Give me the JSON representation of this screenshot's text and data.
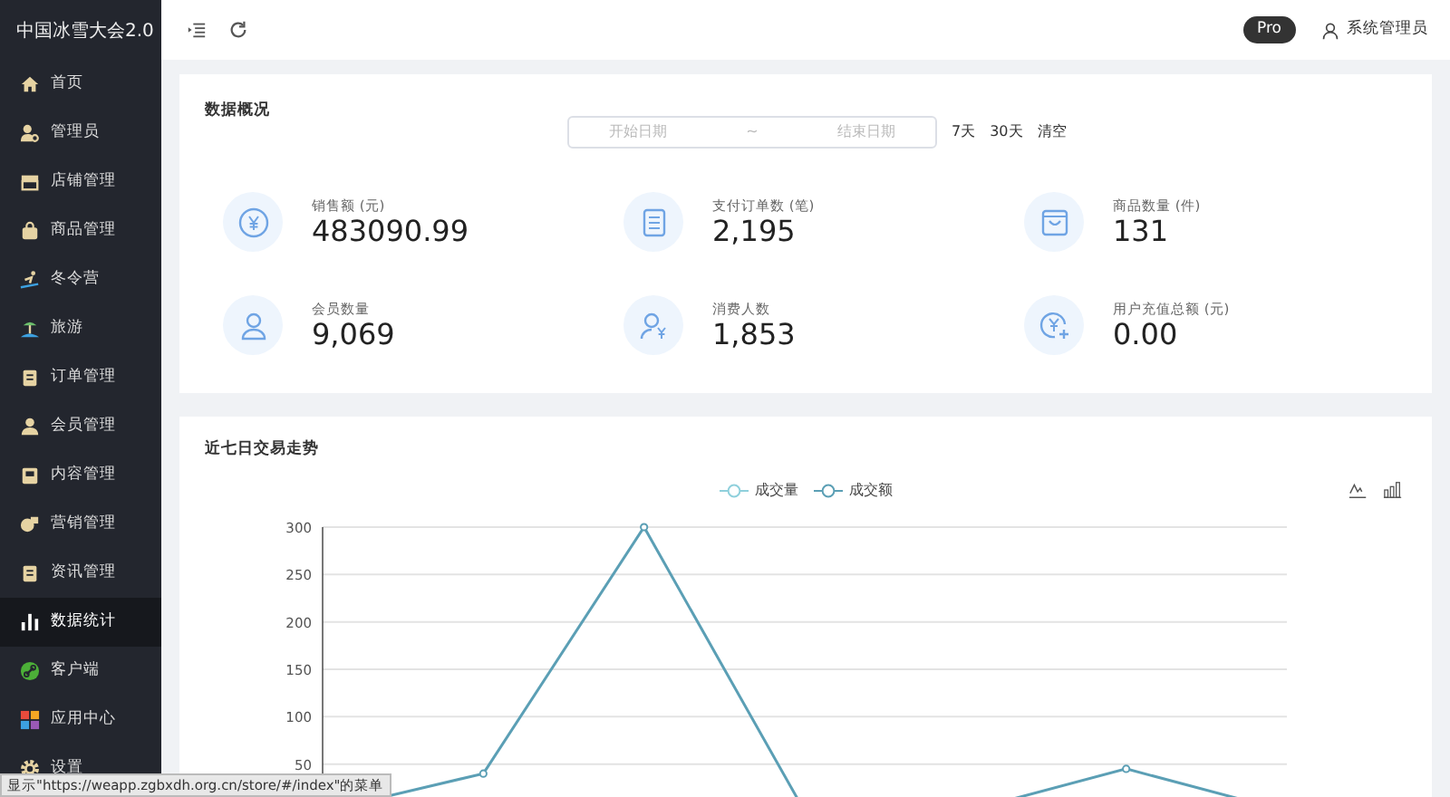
{
  "sidebar": {
    "title": "中国冰雪大会2.0",
    "items": [
      {
        "label": "首页",
        "selected": false
      },
      {
        "label": "管理员",
        "selected": false
      },
      {
        "label": "店铺管理",
        "selected": false
      },
      {
        "label": "商品管理",
        "selected": false
      },
      {
        "label": "冬令营",
        "selected": false
      },
      {
        "label": "旅游",
        "selected": false
      },
      {
        "label": "订单管理",
        "selected": false
      },
      {
        "label": "会员管理",
        "selected": false
      },
      {
        "label": "内容管理",
        "selected": false
      },
      {
        "label": "营销管理",
        "selected": false
      },
      {
        "label": "资讯管理",
        "selected": false
      },
      {
        "label": "数据统计",
        "selected": true
      },
      {
        "label": "客户端",
        "selected": false
      },
      {
        "label": "应用中心",
        "selected": false
      },
      {
        "label": "设置",
        "selected": false
      }
    ]
  },
  "header": {
    "badge": "Pro",
    "user": "系统管理员"
  },
  "overview": {
    "title": "数据概况",
    "date_range": {
      "start_placeholder": "开始日期",
      "separator": "~",
      "end_placeholder": "结束日期"
    },
    "quick_links": [
      "7天",
      "30天",
      "清空"
    ],
    "stats": [
      {
        "label": "销售额 (元)",
        "value": "483090.99"
      },
      {
        "label": "支付订单数 (笔)",
        "value": "2,195"
      },
      {
        "label": "商品数量 (件)",
        "value": "131"
      },
      {
        "label": "会员数量",
        "value": "9,069"
      },
      {
        "label": "消费人数",
        "value": "1,853"
      },
      {
        "label": "用户充值总额 (元)",
        "value": "0.00"
      }
    ]
  },
  "trend": {
    "title": "近七日交易走势",
    "chart_data": {
      "type": "line",
      "grid": true,
      "ylim": [
        0,
        300
      ],
      "yticks": [
        50,
        100,
        150,
        200,
        250,
        300
      ],
      "series": [
        {
          "name": "成交量",
          "color": "#8fd0dc",
          "values": [
            null,
            null,
            null,
            null,
            null,
            null,
            null
          ]
        },
        {
          "name": "成交额",
          "color": "#5b9fb5",
          "marker": "circle",
          "values": [
            0,
            40,
            300,
            0,
            0,
            45,
            0
          ]
        }
      ]
    }
  },
  "status_bar": "显示\"https://weapp.zgbxdh.org.cn/store/#/index\"的菜单"
}
